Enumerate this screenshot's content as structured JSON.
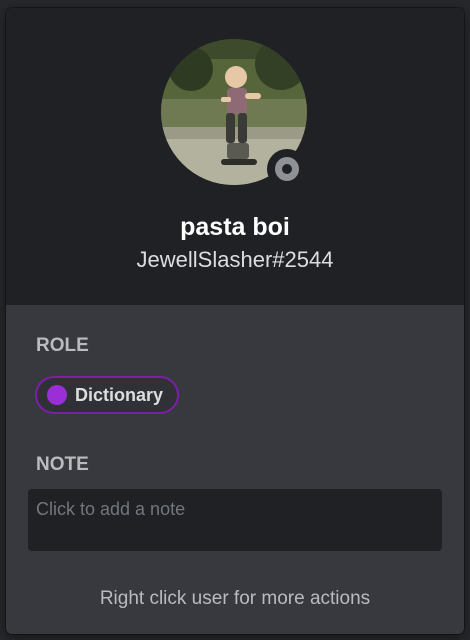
{
  "profile": {
    "display_name": "pasta boi",
    "user_tag": "JewellSlasher#2544",
    "status": "offline",
    "status_color": "#8e9297"
  },
  "roles": {
    "title": "ROLE",
    "items": [
      {
        "name": "Dictionary",
        "color": "#9b2fd7"
      }
    ]
  },
  "note": {
    "title": "NOTE",
    "value": "",
    "placeholder": "Click to add a note"
  },
  "footer": {
    "hint": "Right click user for more actions"
  }
}
